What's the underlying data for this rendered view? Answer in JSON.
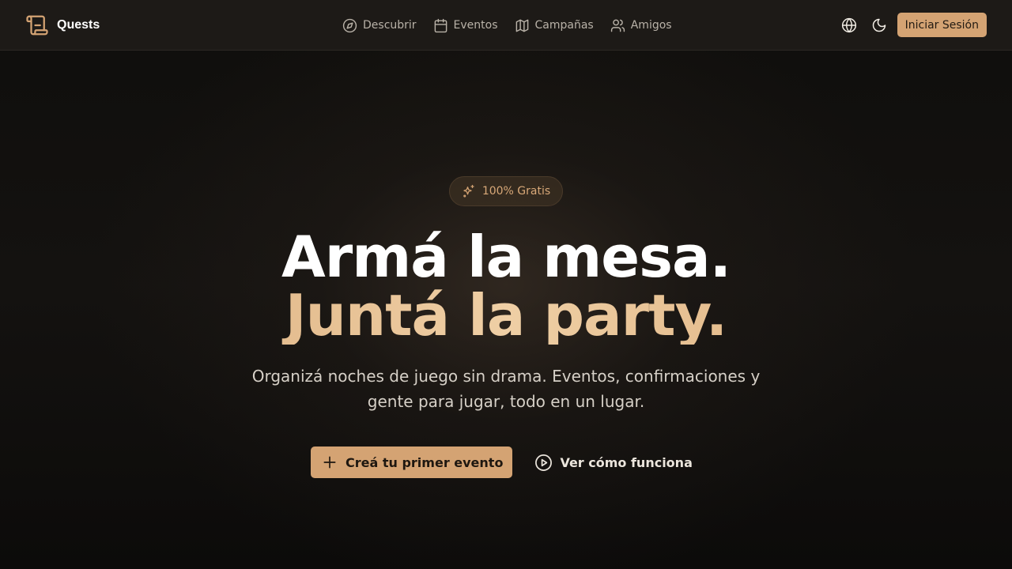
{
  "app": {
    "name": "Quests"
  },
  "nav": {
    "items": [
      {
        "label": "Descubrir",
        "icon": "compass-icon"
      },
      {
        "label": "Eventos",
        "icon": "calendar-icon"
      },
      {
        "label": "Campañas",
        "icon": "map-icon"
      },
      {
        "label": "Amigos",
        "icon": "users-icon"
      }
    ]
  },
  "header_actions": {
    "language_icon": "globe-icon",
    "theme_icon": "moon-icon",
    "login_label": "Iniciar Sesión"
  },
  "hero": {
    "badge": "100% Gratis",
    "badge_icon": "sparkles-icon",
    "title_line1": "Armá la mesa.",
    "title_line2": "Juntá la party.",
    "subtitle": "Organizá noches de juego sin drama. Eventos, confirmaciones y gente para jugar, todo en un lugar.",
    "primary_cta": "Creá tu primer evento",
    "secondary_cta": "Ver cómo funciona"
  },
  "colors": {
    "accent": "#d4a373",
    "header_bg": "#1d1a17",
    "page_bg": "#0d0c0b"
  }
}
